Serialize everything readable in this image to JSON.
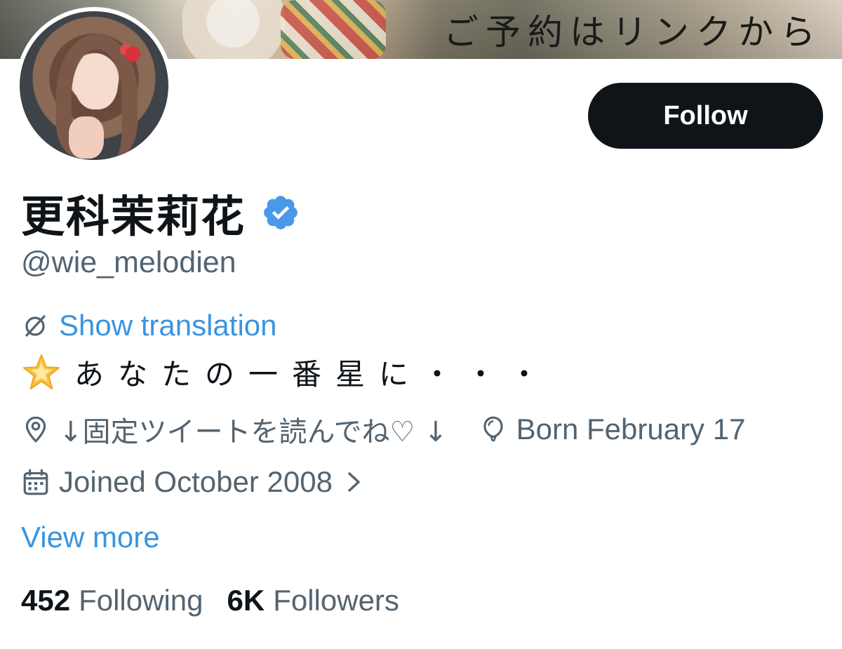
{
  "banner": {
    "text": "ご予約はリンクから"
  },
  "profile": {
    "display_name": "更科茉莉花",
    "verified_icon": "verified-badge-icon",
    "handle": "@wie_melodien",
    "follow_label": "Follow"
  },
  "translation": {
    "label": "Show translation",
    "icon": "translate-icon"
  },
  "bio": {
    "emoji": "glowing-star-icon",
    "text": "あなたの一番星に・・・"
  },
  "meta": {
    "location": "↓固定ツイートを読んでね♡ ↓",
    "location_icon": "location-pin-icon",
    "birthday": "Born February 17",
    "birthday_icon": "balloon-icon",
    "joined": "Joined October 2008",
    "joined_icon": "calendar-icon"
  },
  "view_more": "View more",
  "stats": {
    "following_count": "452",
    "following_label": "Following",
    "followers_count": "6K",
    "followers_label": "Followers"
  },
  "colors": {
    "accent": "#3a94e0",
    "text": "#0f1419",
    "secondary": "#536471",
    "button_bg": "#0f1419"
  }
}
